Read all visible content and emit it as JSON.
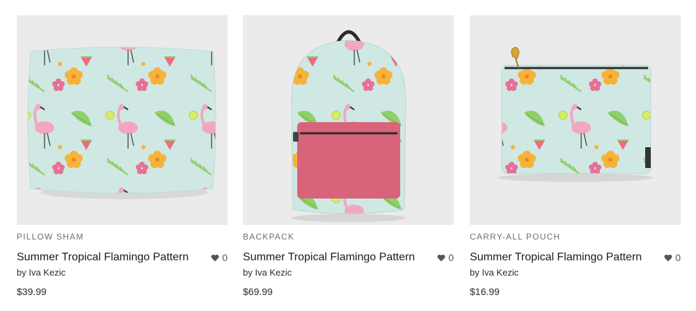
{
  "products": [
    {
      "category": "PILLOW SHAM",
      "title": "Summer Tropical Flamingo Pattern",
      "artist": "by Iva Kezic",
      "likes": "0",
      "price": "$39.99"
    },
    {
      "category": "BACKPACK",
      "title": "Summer Tropical Flamingo Pattern",
      "artist": "by Iva Kezic",
      "likes": "0",
      "price": "$69.99"
    },
    {
      "category": "CARRY-ALL POUCH",
      "title": "Summer Tropical Flamingo Pattern",
      "artist": "by Iva Kezic",
      "likes": "0",
      "price": "$16.99"
    }
  ],
  "colors": {
    "thumb_bg": "#ebebeb",
    "fabric": "#cfe8e4",
    "pink": "#f3a6bd",
    "leaf_green": "#8fcf6a",
    "flower_orange": "#f7b23a",
    "pocket_pink": "#d9637a"
  },
  "icons": {
    "like": "heart-icon"
  }
}
